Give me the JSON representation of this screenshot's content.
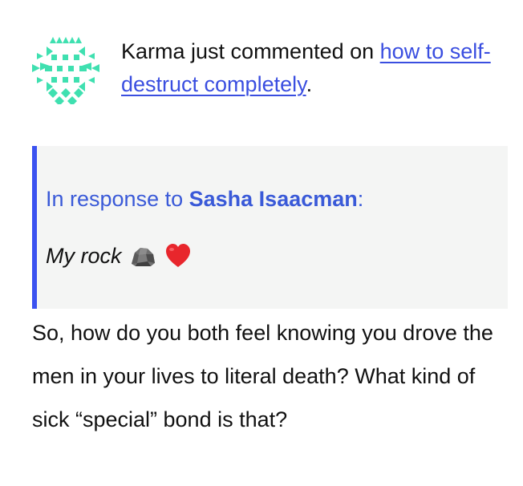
{
  "notification": {
    "avatar_icon": "karma-geometric-avatar-icon",
    "actor": "Karma",
    "action_text": " just commented on ",
    "link_text": "how to self-destruct completely",
    "trailing": "."
  },
  "quote": {
    "prefix": "In response to ",
    "author": "Sasha Isaacman",
    "suffix": ":",
    "text": "My rock",
    "emojis": [
      "rock-emoji-icon",
      "red-heart-emoji-icon"
    ]
  },
  "comment": {
    "body": "So, how do you both feel knowing you drove the men in your lives to literal death? What kind of sick “special” bond is that?"
  },
  "colors": {
    "link": "#3a4ee0",
    "quote_accent": "#3b52f0",
    "quote_bg": "#f4f5f4",
    "avatar": "#3fe0b0"
  }
}
